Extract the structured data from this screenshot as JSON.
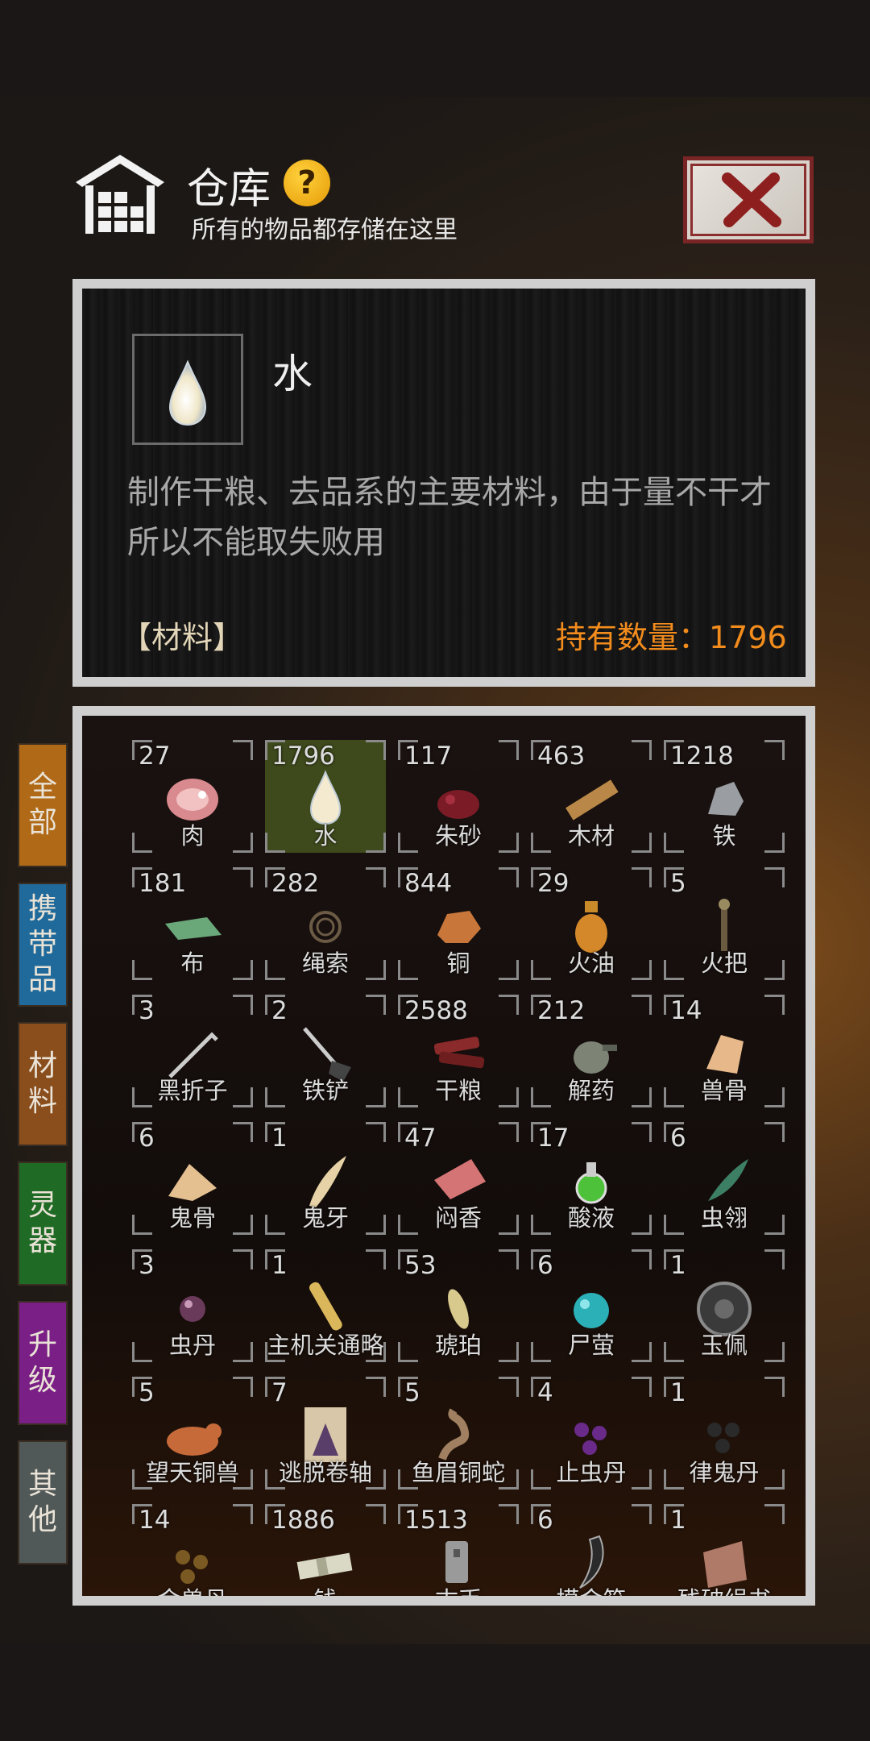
{
  "header": {
    "title": "仓库",
    "help_symbol": "?",
    "subtitle": "所有的物品都存储在这里"
  },
  "detail": {
    "name": "水",
    "description": "制作干粮、去品系的主要材料，由于量不干才所以不能取失败用",
    "category": "【材料】",
    "quantity_label": "持有数量：1796"
  },
  "tabs": [
    {
      "label": "全部",
      "color": "#b06a17"
    },
    {
      "label": "携带品",
      "color": "#1f6a9a"
    },
    {
      "label": "材料",
      "color": "#8a4d1c"
    },
    {
      "label": "灵器",
      "color": "#1f6a24"
    },
    {
      "label": "升级",
      "color": "#7a1f86"
    },
    {
      "label": "其他",
      "color": "#505858"
    }
  ],
  "items": [
    {
      "count": "27",
      "name": "肉",
      "icon": "meat-icon"
    },
    {
      "count": "1796",
      "name": "水",
      "icon": "water-drop-icon",
      "selected": true
    },
    {
      "count": "117",
      "name": "朱砂",
      "icon": "cinnabar-icon"
    },
    {
      "count": "463",
      "name": "木材",
      "icon": "wood-plank-icon"
    },
    {
      "count": "1218",
      "name": "铁",
      "icon": "iron-ore-icon"
    },
    {
      "count": "181",
      "name": "布",
      "icon": "cloth-icon"
    },
    {
      "count": "282",
      "name": "绳索",
      "icon": "rope-icon"
    },
    {
      "count": "844",
      "name": "铜",
      "icon": "copper-ore-icon"
    },
    {
      "count": "29",
      "name": "火油",
      "icon": "fire-oil-icon"
    },
    {
      "count": "5",
      "name": "火把",
      "icon": "torch-icon"
    },
    {
      "count": "3",
      "name": "黑折子",
      "icon": "hook-stick-icon"
    },
    {
      "count": "2",
      "name": "铁铲",
      "icon": "shovel-icon"
    },
    {
      "count": "2588",
      "name": "干粮",
      "icon": "dried-meat-icon"
    },
    {
      "count": "212",
      "name": "解药",
      "icon": "antidote-icon"
    },
    {
      "count": "14",
      "name": "兽骨",
      "icon": "beast-bone-icon"
    },
    {
      "count": "6",
      "name": "鬼骨",
      "icon": "ghost-bone-icon"
    },
    {
      "count": "1",
      "name": "鬼牙",
      "icon": "ghost-tooth-icon"
    },
    {
      "count": "47",
      "name": "闷香",
      "icon": "incense-icon"
    },
    {
      "count": "17",
      "name": "酸液",
      "icon": "acid-flask-icon"
    },
    {
      "count": "6",
      "name": "虫翎",
      "icon": "insect-wing-icon"
    },
    {
      "count": "3",
      "name": "虫丹",
      "icon": "insect-pill-icon"
    },
    {
      "count": "1",
      "name": "主机关通略",
      "icon": "scroll-icon"
    },
    {
      "count": "53",
      "name": "琥珀",
      "icon": "amber-icon"
    },
    {
      "count": "6",
      "name": "尸萤",
      "icon": "corpse-firefly-icon"
    },
    {
      "count": "1",
      "name": "玉佩",
      "icon": "jade-pendant-icon"
    },
    {
      "count": "5",
      "name": "望天铜兽",
      "icon": "bronze-beast-icon"
    },
    {
      "count": "7",
      "name": "逃脱卷轴",
      "icon": "escape-scroll-icon"
    },
    {
      "count": "5",
      "name": "鱼眉铜蛇",
      "icon": "bronze-snake-icon"
    },
    {
      "count": "4",
      "name": "止虫丹",
      "icon": "purple-pills-icon"
    },
    {
      "count": "1",
      "name": "律鬼丹",
      "icon": "dark-pills-icon"
    },
    {
      "count": "14",
      "name": "金兽丹",
      "icon": "gold-pills-icon"
    },
    {
      "count": "1886",
      "name": "钱",
      "icon": "money-stack-icon"
    },
    {
      "count": "1513",
      "name": "古币",
      "icon": "ancient-coin-icon"
    },
    {
      "count": "6",
      "name": "摸金符",
      "icon": "talisman-claw-icon"
    },
    {
      "count": "1",
      "name": "残破绢书",
      "icon": "torn-book-icon"
    }
  ]
}
